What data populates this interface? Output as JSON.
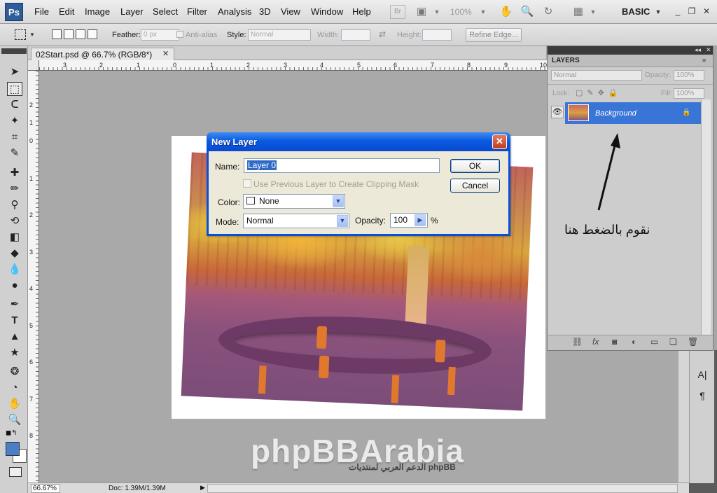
{
  "app": {
    "logo": "Ps",
    "menu": [
      "File",
      "Edit",
      "Image",
      "Layer",
      "Select",
      "Filter",
      "Analysis",
      "3D",
      "View",
      "Window",
      "Help"
    ],
    "bridge_label": "Br",
    "zoom": "100%",
    "workspace": "BASIC"
  },
  "options": {
    "feather_label": "Feather:",
    "feather_value": "0 px",
    "antialias_label": "Anti-alias",
    "style_label": "Style:",
    "style_value": "Normal",
    "width_label": "Width:",
    "height_label": "Height:",
    "refine_edge": "Refine Edge..."
  },
  "document": {
    "tab_title": "02Start.psd @ 66.7% (RGB/8*)",
    "ruler_h": [
      "3",
      "2",
      "1",
      "0",
      "1",
      "2",
      "3",
      "4",
      "5",
      "6",
      "7",
      "8",
      "9",
      "10"
    ],
    "ruler_v": [
      "2",
      "1",
      "0",
      "1",
      "2",
      "3",
      "4",
      "5",
      "6",
      "7",
      "8"
    ]
  },
  "status": {
    "zoom": "66.67%",
    "doc": "Doc: 1.39M/1.39M"
  },
  "watermark": {
    "main": "phpBBArabia",
    "sub": "الدعم العربي لمنتديات phpBB"
  },
  "layers_panel": {
    "title": "LAYERS",
    "blend_mode": "Normal",
    "opacity_label": "Opacity:",
    "opacity_value": "100%",
    "lock_label": "Lock:",
    "fill_label": "Fill:",
    "fill_value": "100%",
    "layers": [
      {
        "name": "Background",
        "visible": true,
        "locked": true,
        "selected": true
      }
    ]
  },
  "annotation": {
    "text": "نقوم بالضغط هنا"
  },
  "new_layer_dialog": {
    "title": "New Layer",
    "close": "✕",
    "name_label": "Name:",
    "name_value": "Layer 0",
    "clipping_label": "Use Previous Layer to Create Clipping Mask",
    "color_label": "Color:",
    "color_value": "None",
    "mode_label": "Mode:",
    "mode_value": "Normal",
    "opacity_label": "Opacity:",
    "opacity_value": "100",
    "percent": "%",
    "ok": "OK",
    "cancel": "Cancel"
  },
  "right_column": {
    "char_icon": "A|",
    "para_icon": "¶"
  },
  "colors": {
    "selection_blue": "#3875d7",
    "xp_title_blue": "#0a5be0",
    "xp_close_red": "#c13d1c",
    "canvas_gray": "#a9a9a9"
  }
}
